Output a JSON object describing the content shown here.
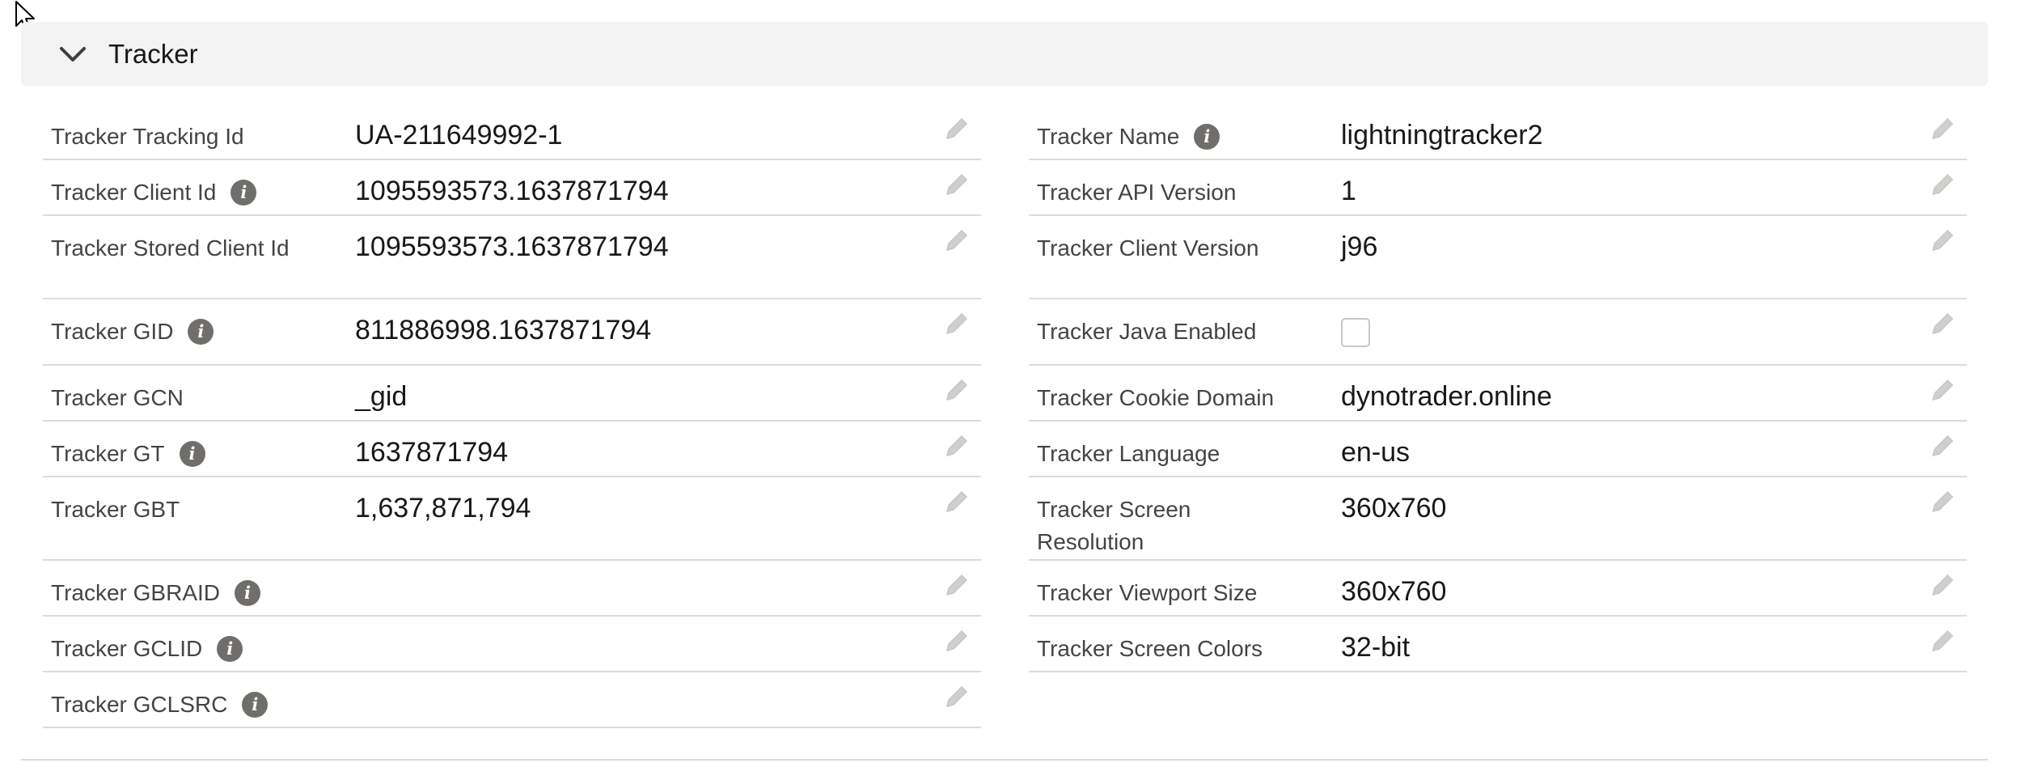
{
  "section": {
    "title": "Tracker",
    "expand_icon": "chevron-down-icon"
  },
  "left_fields": [
    {
      "label": "Tracker Tracking Id",
      "value": "UA-211649992-1",
      "info": false
    },
    {
      "label": "Tracker Client Id",
      "value": "1095593573.1637871794",
      "info": true
    },
    {
      "label": "Tracker Stored Client Id",
      "value": "1095593573.1637871794",
      "info": false
    },
    {
      "label": "Tracker GID",
      "value": "811886998.1637871794",
      "info": true
    },
    {
      "label": "Tracker GCN",
      "value": "_gid",
      "info": false
    },
    {
      "label": "Tracker GT",
      "value": "1637871794",
      "info": true
    },
    {
      "label": "Tracker GBT",
      "value": "1,637,871,794",
      "info": false
    },
    {
      "label": "Tracker GBRAID",
      "value": "",
      "info": true
    },
    {
      "label": "Tracker GCLID",
      "value": "",
      "info": true
    },
    {
      "label": "Tracker GCLSRC",
      "value": "",
      "info": true
    }
  ],
  "right_fields": [
    {
      "label": "Tracker Name",
      "value": "lightningtracker2",
      "info": true
    },
    {
      "label": "Tracker API Version",
      "value": "1",
      "info": false
    },
    {
      "label": "Tracker Client Version",
      "value": "j96",
      "info": false
    },
    {
      "label": "Tracker Java Enabled",
      "value": "",
      "checked": false
    },
    {
      "label": "Tracker Cookie Domain",
      "value": "dynotrader.online",
      "info": false
    },
    {
      "label": "Tracker Language",
      "value": "en-us",
      "info": false
    },
    {
      "label": "Tracker Screen Resolution",
      "value": "360x760",
      "info": false
    },
    {
      "label": "Tracker Viewport Size",
      "value": "360x760",
      "info": false
    },
    {
      "label": "Tracker Screen Colors",
      "value": "32-bit",
      "info": false
    }
  ],
  "icons": {
    "info": "info-icon",
    "edit": "pencil-edit-icon",
    "cursor": "mouse-pointer-icon"
  },
  "colors": {
    "header_bg": "#f3f3f3",
    "divider": "#dddbda",
    "info_badge": "#706e6b",
    "edit_icon": "#c9c7c5"
  }
}
